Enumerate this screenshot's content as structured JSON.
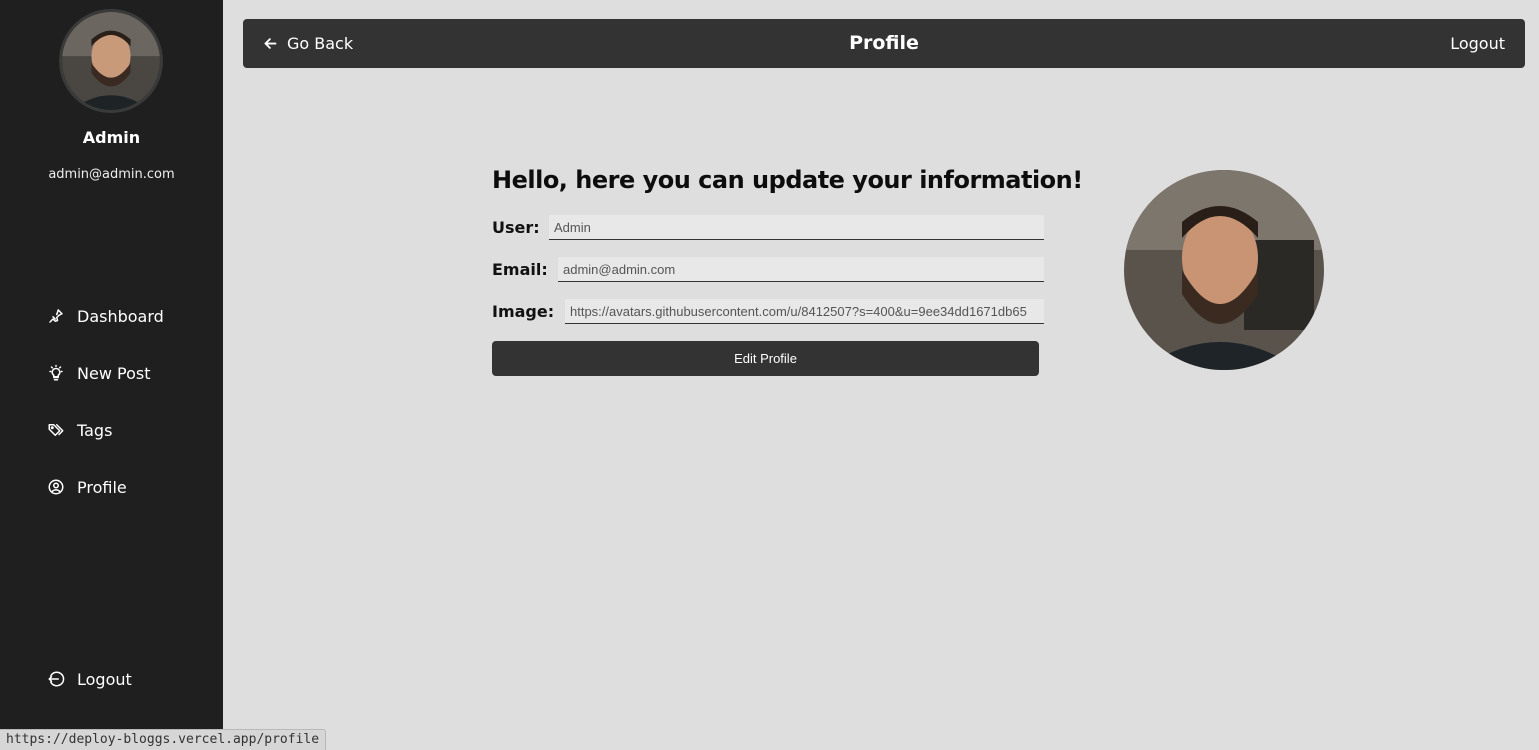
{
  "sidebar": {
    "user_name": "Admin",
    "user_email": "admin@admin.com",
    "nav": [
      {
        "label": "Dashboard",
        "icon": "pin-icon"
      },
      {
        "label": "New Post",
        "icon": "lightbulb-icon"
      },
      {
        "label": "Tags",
        "icon": "tags-icon"
      },
      {
        "label": "Profile",
        "icon": "user-circle-icon"
      }
    ],
    "logout_label": "Logout"
  },
  "topbar": {
    "back_label": "Go Back",
    "title": "Profile",
    "logout_label": "Logout"
  },
  "form": {
    "heading": "Hello, here you can update your information!",
    "user_label": "User:",
    "user_value": "Admin",
    "email_label": "Email:",
    "email_value": "admin@admin.com",
    "image_label": "Image:",
    "image_value": "https://avatars.githubusercontent.com/u/8412507?s=400&u=9ee34dd1671db65",
    "submit_label": "Edit Profile"
  },
  "statusbar": {
    "url": "https://deploy-bloggs.vercel.app/profile"
  },
  "colors": {
    "sidebar_bg": "#1f1f1f",
    "topbar_bg": "#333333",
    "page_bg": "#dedede"
  }
}
